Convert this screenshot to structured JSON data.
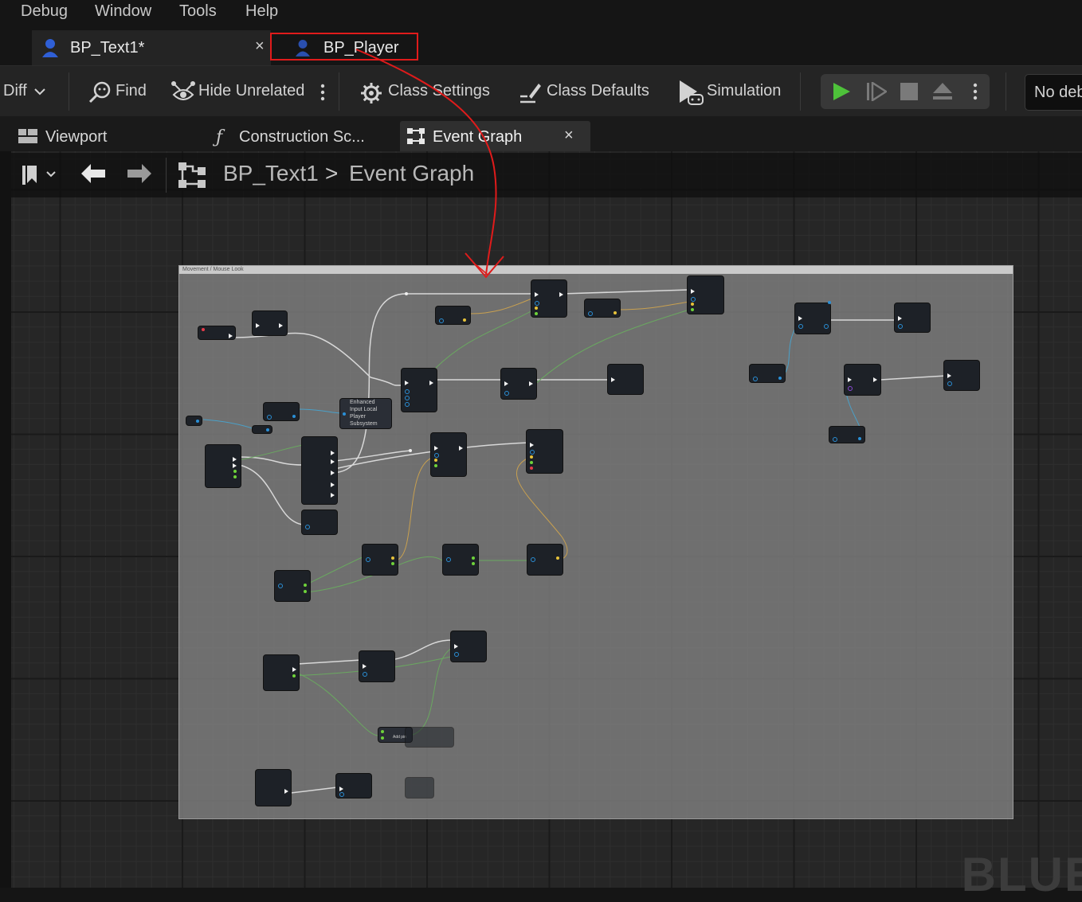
{
  "menu": {
    "items": [
      "Debug",
      "Window",
      "Tools",
      "Help"
    ]
  },
  "doc_tabs": [
    {
      "label": "BP_Text1*",
      "close": "×",
      "active": true
    },
    {
      "label": "BP_Player",
      "active": false,
      "highlighted": true
    }
  ],
  "toolbar": {
    "diff_label": "Diff",
    "find_label": "Find",
    "hide_unrelated_label": "Hide Unrelated",
    "class_settings_label": "Class Settings",
    "class_defaults_label": "Class Defaults",
    "simulation_label": "Simulation",
    "debug_filter_label": "No deb"
  },
  "graph_tabs": [
    {
      "label": "Viewport",
      "active": false
    },
    {
      "label": "Construction Sc...",
      "active": false
    },
    {
      "label": "Event Graph",
      "active": true,
      "close": "×"
    }
  ],
  "breadcrumb": {
    "blueprint": "BP_Text1",
    "separator": ">",
    "graph": "Event Graph"
  },
  "comment_box": {
    "title": "Movement / Mouse Look"
  },
  "graph_node_text": {
    "enhanced_input": [
      "Enhanced",
      "Input Local",
      "Player",
      "Subsystem"
    ],
    "add_pin": "Add pin"
  },
  "watermark": "BLUE",
  "colors": {
    "annotation_red": "#e01b1b",
    "play_green": "#4ec23a",
    "exec_pin": "#f2f2f2",
    "pin_blue": "#2a8fd6",
    "pin_green": "#6ed33a",
    "pin_yellow": "#e6c23a"
  }
}
